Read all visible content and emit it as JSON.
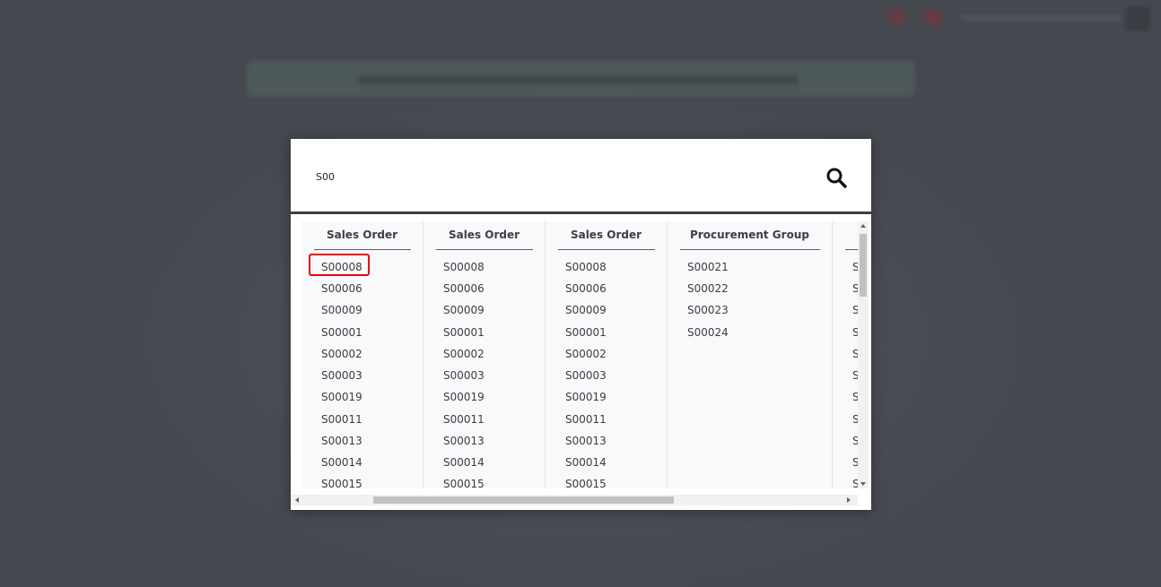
{
  "search": {
    "value": "S00"
  },
  "columns": [
    {
      "title": "Sales Order",
      "items": [
        "S00008",
        "S00006",
        "S00009",
        "S00001",
        "S00002",
        "S00003",
        "S00019",
        "S00011",
        "S00013",
        "S00014",
        "S00015"
      ]
    },
    {
      "title": "Sales Order",
      "items": [
        "S00008",
        "S00006",
        "S00009",
        "S00001",
        "S00002",
        "S00003",
        "S00019",
        "S00011",
        "S00013",
        "S00014",
        "S00015"
      ]
    },
    {
      "title": "Sales Order",
      "items": [
        "S00008",
        "S00006",
        "S00009",
        "S00001",
        "S00002",
        "S00003",
        "S00019",
        "S00011",
        "S00013",
        "S00014",
        "S00015"
      ]
    },
    {
      "title": "Procurement Group",
      "items": [
        "S00021",
        "S00022",
        "S00023",
        "S00024"
      ]
    },
    {
      "title": "",
      "items": [
        "S",
        "S",
        "S",
        "S",
        "S",
        "S",
        "S",
        "S",
        "S",
        "S",
        "S"
      ]
    }
  ],
  "colors": {
    "highlight": "#e8000c",
    "overlay": "#474a52",
    "search_border": "#3b3d42"
  }
}
